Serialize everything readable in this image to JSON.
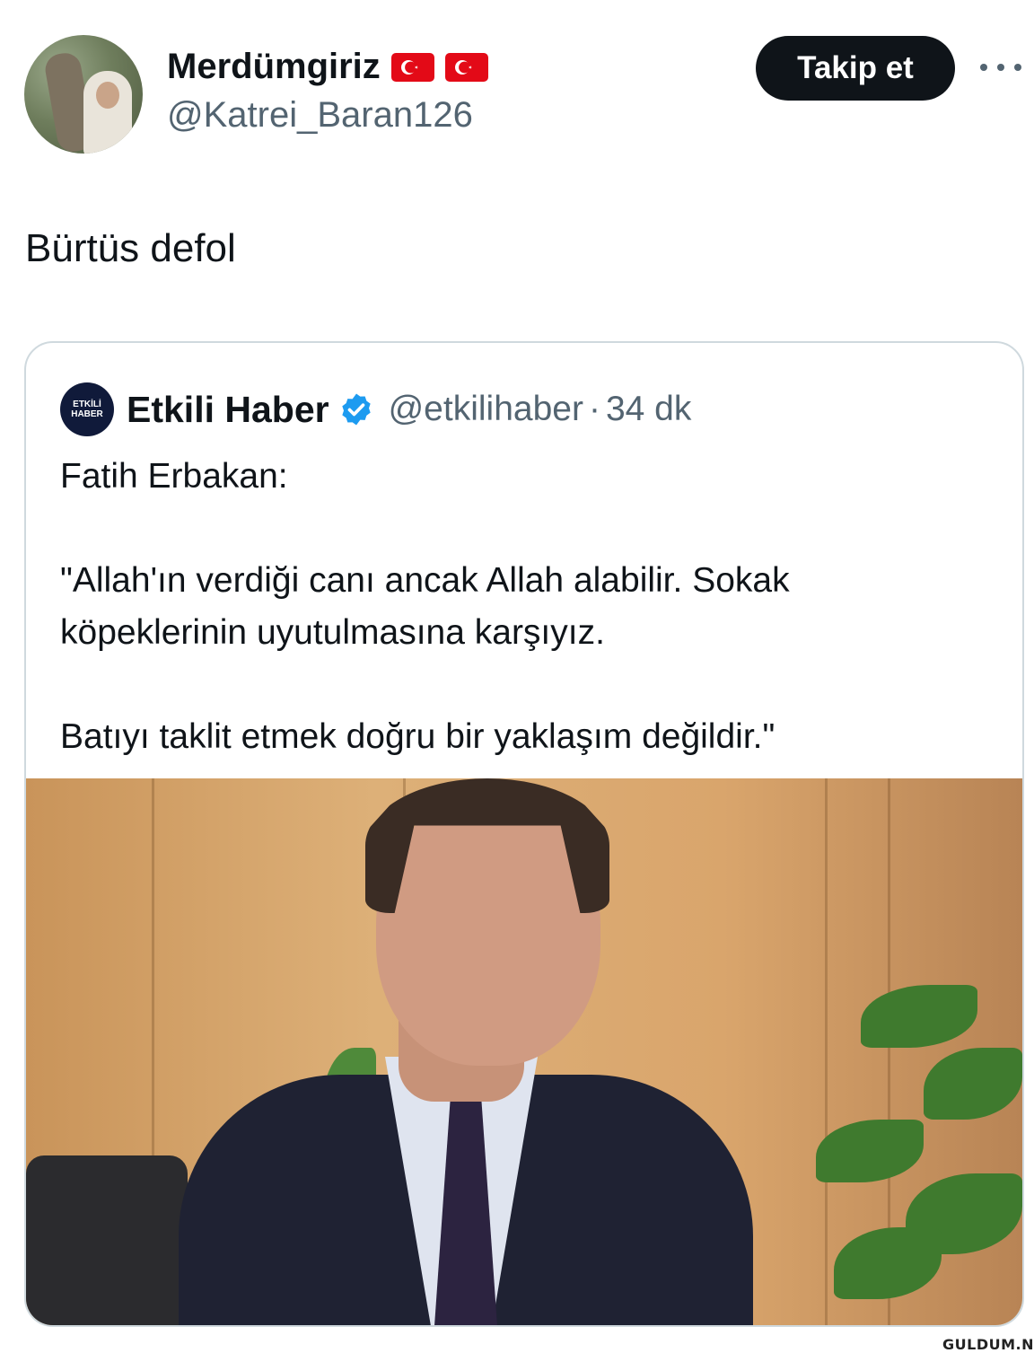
{
  "author": {
    "display_name": "Merdümgiriz",
    "flags": [
      "turkey-flag-icon",
      "turkey-flag-icon"
    ],
    "handle": "@Katrei_Baran126"
  },
  "actions": {
    "follow_label": "Takip et",
    "more_icon": "more-dots-icon"
  },
  "tweet": {
    "text": "Bürtüs defol"
  },
  "quoted_tweet": {
    "logo_text_line1": "ETKİLİ",
    "logo_text_line2": "HABER",
    "display_name": "Etkili Haber",
    "verified_icon": "verified-badge-icon",
    "handle": "@etkilihaber",
    "separator": "·",
    "time": "34 dk",
    "line1": "Fatih Erbakan:",
    "line2": "\"Allah'ın verdiği canı ancak Allah alabilir. Sokak",
    "line3": "köpeklerinin uyutulmasına karşıyız.",
    "line4": "Batıyı taklit etmek doğru bir yaklaşım değildir.\""
  },
  "watermark": "GULDUM.NET",
  "colors": {
    "follow_button_bg": "#0f1419",
    "handle_gray": "#536471",
    "verified_blue": "#1d9bf0",
    "border": "#cfd9de"
  }
}
